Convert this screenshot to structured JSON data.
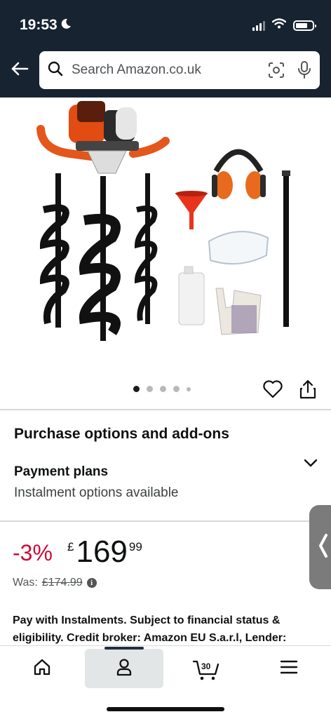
{
  "status_bar": {
    "time": "19:53"
  },
  "search": {
    "placeholder": "Search Amazon.co.uk"
  },
  "gallery": {
    "dot_count": 5,
    "active_index": 0
  },
  "purchase": {
    "title": "Purchase options and add-ons",
    "payment_plans_label": "Payment plans",
    "payment_plans_sub": "Instalment options available"
  },
  "pricing": {
    "discount": "-3%",
    "currency": "£",
    "whole": "169",
    "fraction": "99",
    "was_label": "Was:",
    "was_price": "£174.99",
    "instalments_text": "Pay with Instalments. Subject to financial status & eligibility. Credit broker: Amazon EU S.a.r.l, Lender:"
  },
  "nav": {
    "cart_count": "30"
  },
  "colors": {
    "header_bg": "#172331",
    "discount_red": "#cc0c39",
    "nav_selected": "#e3e6e6"
  },
  "icons": [
    "back-arrow-icon",
    "search-icon",
    "camera-scan-icon",
    "microphone-icon",
    "heart-icon",
    "share-icon",
    "chevron-down-icon",
    "info-icon",
    "home-icon",
    "account-icon",
    "cart-icon",
    "menu-icon"
  ]
}
